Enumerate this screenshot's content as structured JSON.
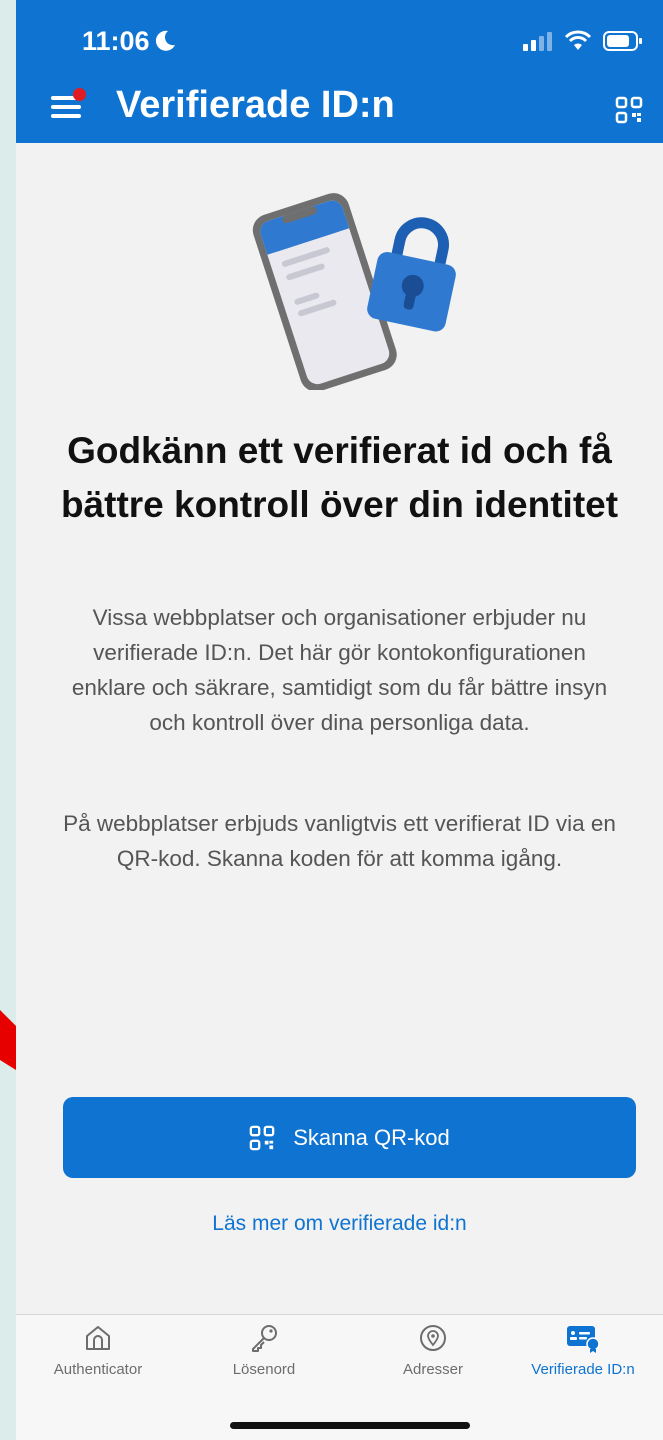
{
  "status": {
    "time": "11:06"
  },
  "header": {
    "title": "Verifierade ID:n"
  },
  "hero": {
    "headline": "Godkänn ett verifierat id och få bättre kontroll över din identitet",
    "paragraph1": "Vissa webbplatser och organisationer erbjuder nu verifierade ID:n. Det här gör kontokonfigurationen enklare och säkrare, samtidigt som du får bättre insyn och kontroll över dina personliga data.",
    "paragraph2": "På webbplatser erbjuds vanligtvis ett verifierat ID via en QR-kod. Skanna koden för att komma igång."
  },
  "cta": {
    "label": "Skanna QR-kod"
  },
  "link": {
    "label": "Läs mer om verifierade id:n"
  },
  "tabs": [
    {
      "label": "Authenticator",
      "icon": "home-icon"
    },
    {
      "label": "Lösenord",
      "icon": "key-icon"
    },
    {
      "label": "Adresser",
      "icon": "location-pin-icon"
    },
    {
      "label": "Verifierade ID:n",
      "icon": "id-card-icon",
      "active": true
    }
  ],
  "colors": {
    "accent": "#0f74d1",
    "notification": "#e11b22",
    "annotation_arrow": "#e60000"
  }
}
